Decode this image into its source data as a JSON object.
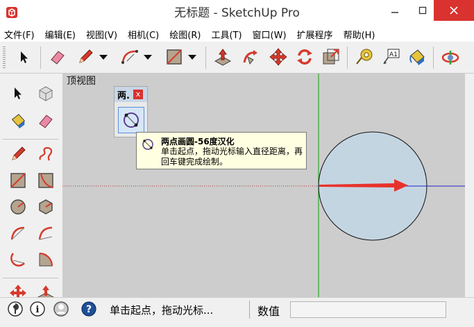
{
  "window": {
    "title": "无标题 - SketchUp Pro",
    "controls": {
      "minimize": "—",
      "maximize": "□",
      "close": "✕"
    }
  },
  "menu": [
    "文件(F)",
    "编辑(E)",
    "视图(V)",
    "相机(C)",
    "绘图(R)",
    "工具(T)",
    "窗口(W)",
    "扩展程序",
    "帮助(H)"
  ],
  "toolbar": {
    "icons": [
      "select-arrow-icon",
      "eraser-icon",
      "pencil-icon",
      "dropdown-arrow-icon",
      "arc-icon",
      "dropdown-arrow-icon",
      "rectangle-icon",
      "dropdown-arrow-icon",
      "push-pull-icon",
      "follow-me-icon",
      "move-icon",
      "rotate-icon",
      "scale-icon",
      "tape-measure-icon",
      "text-label-icon",
      "paint-bucket-icon",
      "orbit-icon"
    ],
    "text_tool_label": "A1"
  },
  "viewport": {
    "view_label": "顶视图",
    "background": "#cdcdcd",
    "axis_red": "#c0392b",
    "axis_green": "#2ea82e",
    "axis_blue": "#2424c8",
    "circle_fill": "#c4d5e2"
  },
  "floating_toolbar": {
    "title": "两.",
    "close": "x",
    "tool_icon": "two-point-circle-icon"
  },
  "tooltip": {
    "title": "两点画圆-56度汉化",
    "body": "单击起点，拖动光标输入直径距离，再回车键完成绘制。"
  },
  "status": {
    "icons": [
      "geo-location-icon",
      "credits-info-icon",
      "user-account-icon",
      "help-icon"
    ],
    "help_glyph": "?",
    "info_glyph": "i",
    "message": "单击起点，拖动光标...",
    "vcb_label": "数值",
    "vcb_value": ""
  }
}
